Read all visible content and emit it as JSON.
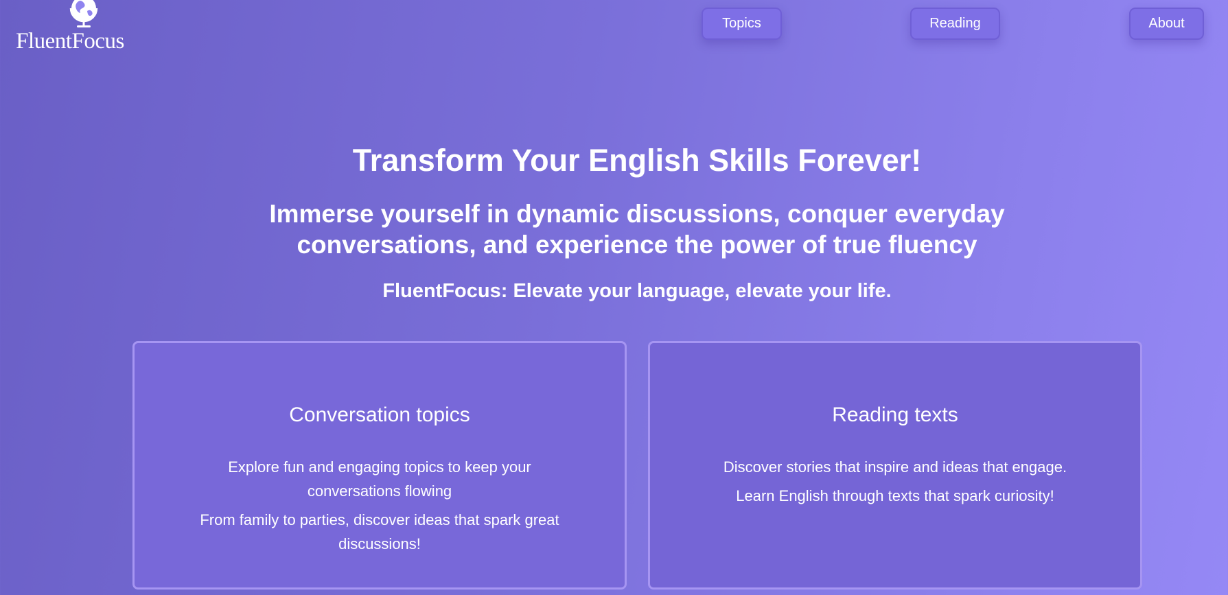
{
  "brand": {
    "name": "FluentFocus",
    "logo_icon": "globe-icon"
  },
  "nav": {
    "topics": "Topics",
    "reading": "Reading",
    "about": "About"
  },
  "hero": {
    "title": "Transform Your English Skills Forever!",
    "subtitle": "Immerse yourself in dynamic discussions, conquer everyday conversations, and experience the power of true fluency",
    "tagline": "FluentFocus: Elevate your language, elevate your life."
  },
  "cards": [
    {
      "title": "Conversation topics",
      "lines": [
        "Explore fun and engaging topics to keep your conversations flowing",
        "From family to parties, discover ideas that spark great discussions!"
      ]
    },
    {
      "title": "Reading texts",
      "lines": [
        "Discover stories that inspire and ideas that engage.",
        "Learn English through texts that spark curiosity!"
      ]
    }
  ],
  "colors": {
    "background_start": "#6a5fc6",
    "background_end": "#9588f5",
    "button_border": "#6f5fd6",
    "card_border": "#a695f2",
    "text": "#ffffff"
  }
}
